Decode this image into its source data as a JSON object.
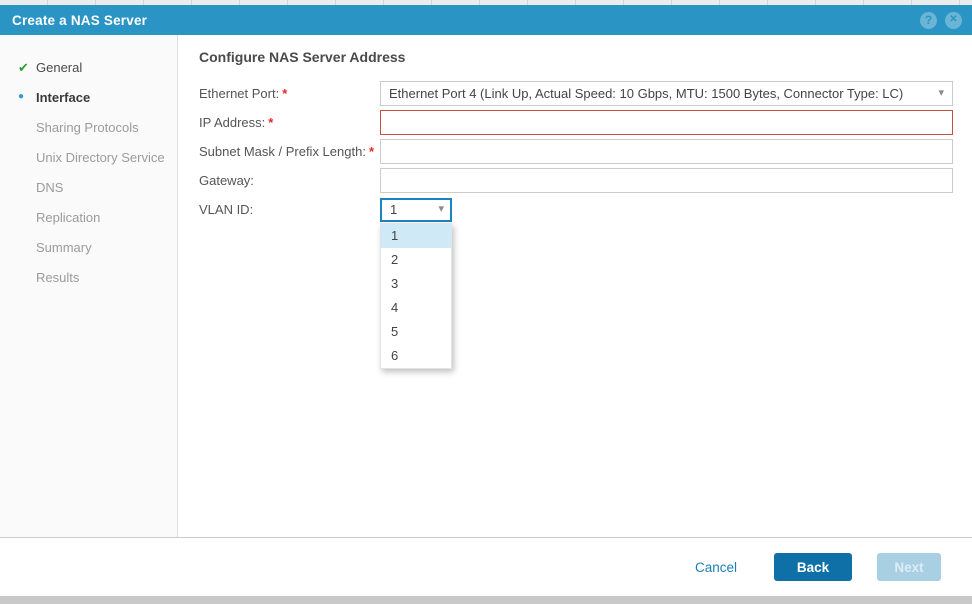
{
  "titlebar": {
    "title": "Create a NAS Server"
  },
  "icons": {
    "help": "?",
    "close": "✕",
    "check": "✔",
    "dot": "●",
    "dropdown_arrow": "▾"
  },
  "sidebar": {
    "items": [
      {
        "label": "General",
        "state": "done"
      },
      {
        "label": "Interface",
        "state": "active"
      },
      {
        "label": "Sharing Protocols",
        "state": "pending"
      },
      {
        "label": "Unix Directory Service",
        "state": "pending"
      },
      {
        "label": "DNS",
        "state": "pending"
      },
      {
        "label": "Replication",
        "state": "pending"
      },
      {
        "label": "Summary",
        "state": "pending"
      },
      {
        "label": "Results",
        "state": "pending"
      }
    ]
  },
  "content": {
    "heading": "Configure NAS Server Address",
    "required_marker": "*",
    "fields": {
      "ethernet_port": {
        "label": "Ethernet Port:",
        "required": true,
        "value": "Ethernet Port 4 (Link Up, Actual Speed: 10 Gbps, MTU: 1500 Bytes, Connector Type: LC)"
      },
      "ip_address": {
        "label": "IP Address:",
        "required": true,
        "value": ""
      },
      "subnet_mask": {
        "label": "Subnet Mask / Prefix Length:",
        "required": true,
        "value": ""
      },
      "gateway": {
        "label": "Gateway:",
        "required": false,
        "value": ""
      },
      "vlan_id": {
        "label": "VLAN ID:",
        "selected": "1",
        "options": [
          "1",
          "2",
          "3",
          "4",
          "5",
          "6"
        ]
      }
    }
  },
  "footer": {
    "cancel_label": "Cancel",
    "back_label": "Back",
    "next_label": "Next"
  },
  "colors": {
    "titlebar_blue": "#2a94c4",
    "focus_blue": "#1b84c4",
    "back_button_blue": "#0e70a6",
    "next_disabled_blue": "#a9cfe3",
    "error_red": "#c6503c",
    "required_red": "#e02b2b",
    "step_done_green": "#2f9e2f",
    "step_active_dot": "#2e9bd6",
    "option_highlight": "#cfe9f7"
  }
}
